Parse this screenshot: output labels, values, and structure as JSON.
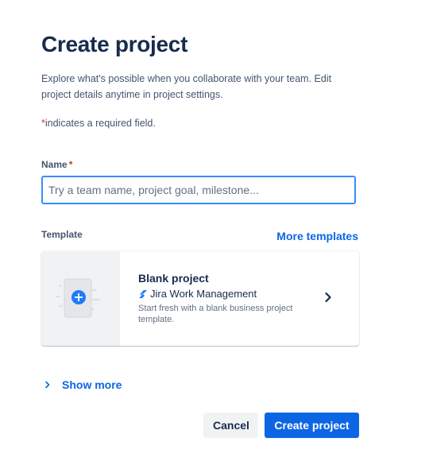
{
  "page": {
    "title": "Create project",
    "description": "Explore what's possible when you collaborate with your team. Edit project details anytime in project settings.",
    "required_asterisk": "*",
    "required_note": "indicates a required field."
  },
  "name_field": {
    "label": "Name",
    "required_marker": "*",
    "placeholder": "Try a team name, project goal, milestone...",
    "value": ""
  },
  "template_section": {
    "label": "Template",
    "more_templates_link": "More templates",
    "card": {
      "title": "Blank project",
      "product": "Jira Work Management",
      "description": "Start fresh with a blank business project template.",
      "thumbnail_icon": "plus-circle-icon",
      "product_icon": "jira-logo-icon",
      "chevron_icon": "chevron-right-icon"
    }
  },
  "show_more": {
    "label": "Show more",
    "icon": "chevron-right-icon"
  },
  "actions": {
    "cancel_label": "Cancel",
    "create_label": "Create project"
  },
  "colors": {
    "primary": "#0c66e4",
    "text": "#172b4d",
    "subtle_text": "#44546f",
    "required": "#c9372c",
    "focus_border": "#388bff",
    "neutral_button": "#f1f2f4"
  }
}
